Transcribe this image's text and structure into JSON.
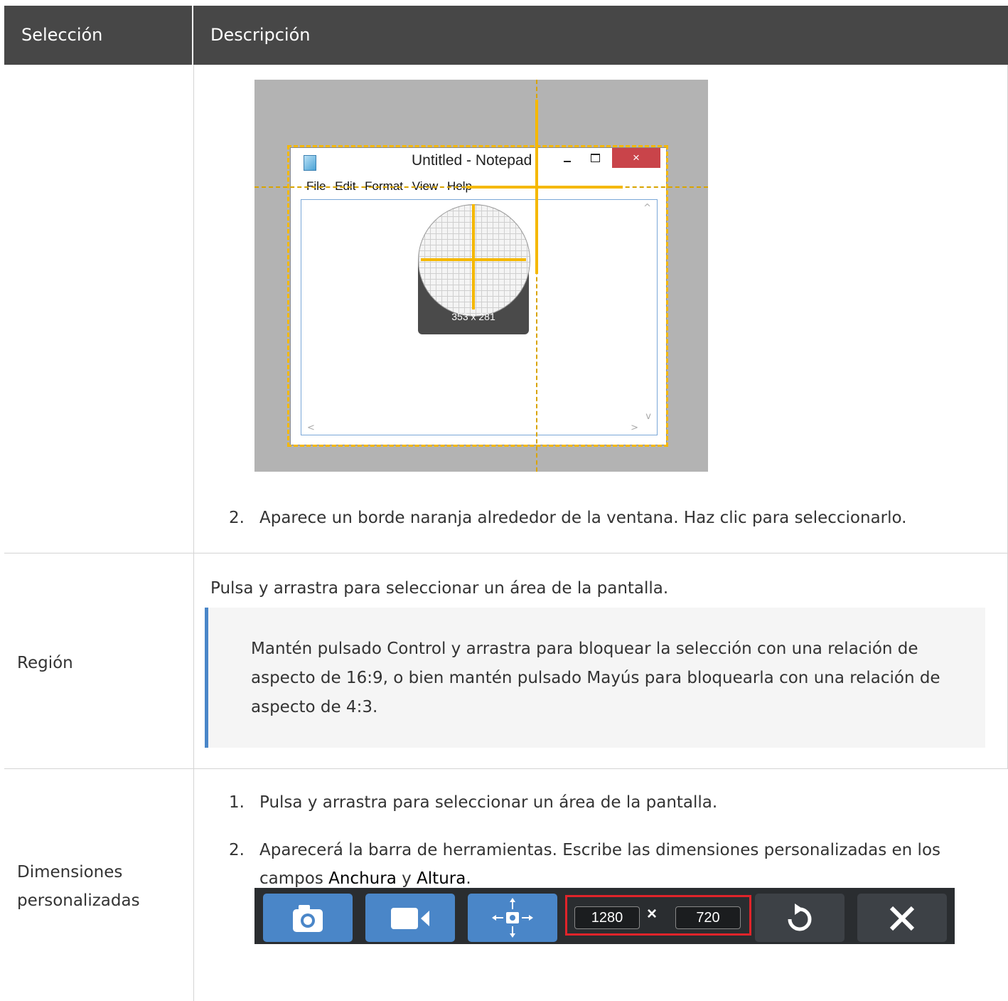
{
  "header": {
    "col1": "Selección",
    "col2": "Descripción"
  },
  "row_window": {
    "screenshot": {
      "window_title": "Untitled - Notepad",
      "close_glyph": "×",
      "menu": [
        "File",
        "Edit",
        "Format",
        "View",
        "Help"
      ],
      "dimensions": "353 x 281",
      "scroll_up": "^",
      "scroll_down": "v",
      "scroll_left": "<",
      "scroll_right": ">"
    },
    "step_number": "2.",
    "step_text": "Aparece un borde naranja alrededor de la ventana. Haz clic para seleccionarlo."
  },
  "row_region": {
    "label": "Región",
    "intro": "Pulsa y arrastra para seleccionar un área de la pantalla.",
    "note": "Mantén pulsado Control y arrastra para bloquear la selección con una relación de aspecto de 16:9, o bien mantén pulsado Mayús para bloquearla con una relación de aspecto de 4:3."
  },
  "row_custom": {
    "label_line1": "Dimensiones",
    "label_line2": "personalizadas",
    "step1_number": "1.",
    "step1_text": "Pulsa y arrastra para seleccionar un área de la pantalla.",
    "step2_number": "2.",
    "step2_prefix": "Aparecerá la barra de herramientas. Escribe las dimensiones personalizadas en los",
    "step2_campos": "campos",
    "step2_kw1": "Anchura",
    "step2_y": "y",
    "step2_kw2": "Altura",
    "step2_period": ".",
    "toolbar": {
      "width_value": "1280",
      "times": "×",
      "height_value": "720",
      "icons": [
        "camera-icon",
        "video-icon",
        "move-icon",
        "redo-icon",
        "close-icon"
      ],
      "accent": "#4a86c8",
      "highlight": "#e0242a"
    }
  }
}
